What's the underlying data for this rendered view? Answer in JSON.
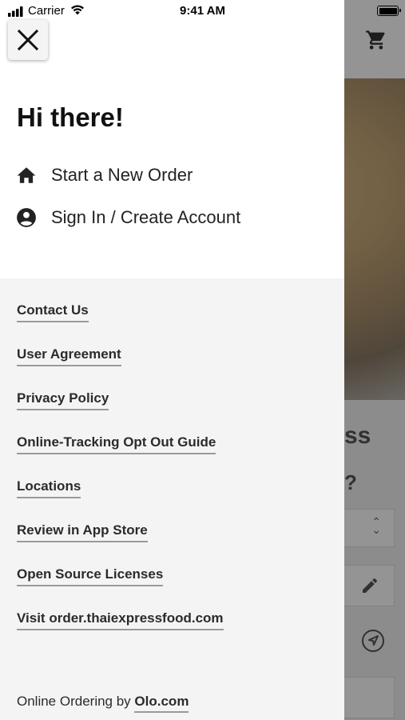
{
  "status_bar": {
    "carrier": "Carrier",
    "time": "9:41 AM"
  },
  "drawer": {
    "greeting": "Hi there!",
    "actions": [
      {
        "label": "Start a New Order",
        "icon": "home-icon"
      },
      {
        "label": "Sign In / Create Account",
        "icon": "account-circle-icon"
      }
    ],
    "links": [
      "Contact Us",
      "User Agreement",
      "Privacy Policy",
      "Online-Tracking Opt Out Guide",
      "Locations",
      "Review in App Store",
      "Open Source Licenses",
      "Visit order.thaiexpressfood.com"
    ],
    "footer": {
      "prefix": "Online Ordering by",
      "link": "Olo.com"
    }
  },
  "background": {
    "title_fragment": "ss",
    "question_fragment": "?"
  },
  "colors": {
    "drawer_top": "#ffffff",
    "drawer_bottom": "#f4f4f4",
    "text": "#222222",
    "link_underline": "#9a9a9a"
  }
}
